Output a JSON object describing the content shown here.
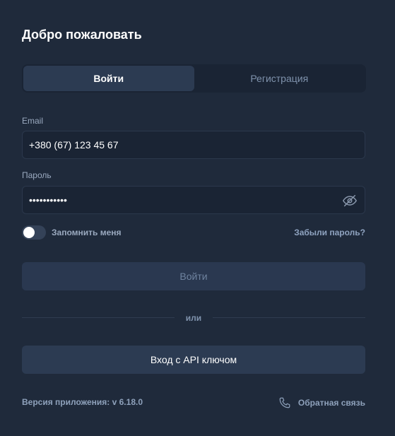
{
  "title": "Добро пожаловать",
  "tabs": [
    {
      "label": "Войти",
      "active": true
    },
    {
      "label": "Регистрация",
      "active": false
    }
  ],
  "email": {
    "label": "Email",
    "value": "+380 (67) 123 45 67"
  },
  "password": {
    "label": "Пароль",
    "value": "•••••••••••",
    "toggle_icon": "eye-off-icon"
  },
  "remember": {
    "label": "Запомнить меня",
    "checked": false
  },
  "forgot_label": "Забыли пароль?",
  "login_button": "Войти",
  "divider_text": "или",
  "api_button": "Вход с API ключом",
  "footer": {
    "version": "Версия приложения: v 6.18.0",
    "feedback_label": "Обратная связь",
    "feedback_icon": "phone-icon"
  },
  "colors": {
    "background": "#1f2a3b",
    "field_bg": "#1a2434",
    "button_bg": "#2c3b52",
    "muted_text": "#9aa9bf"
  }
}
